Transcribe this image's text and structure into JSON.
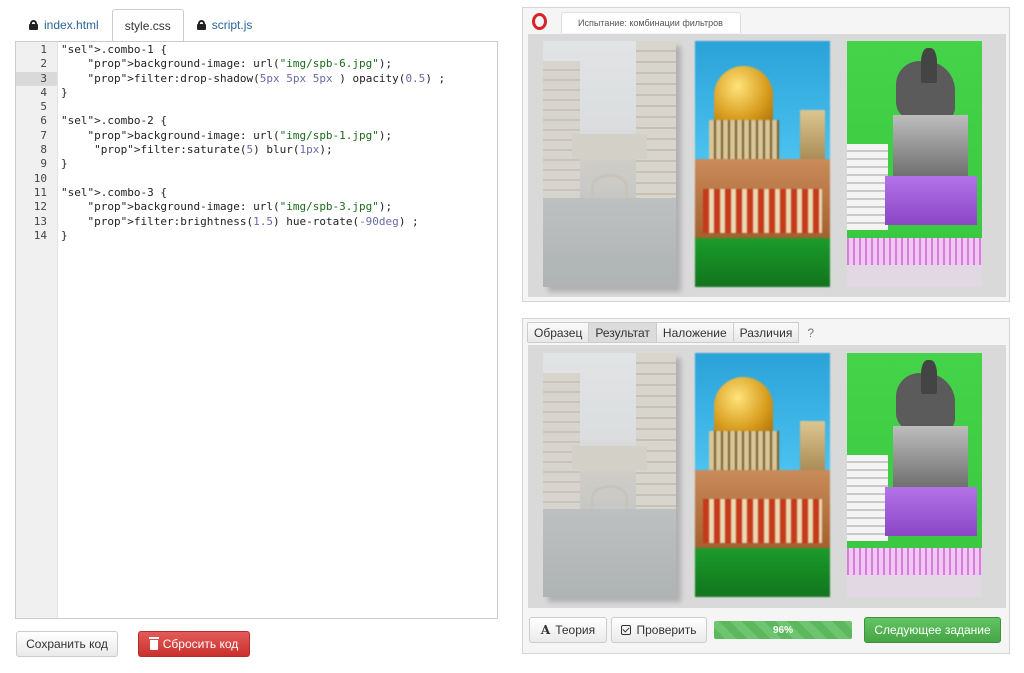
{
  "editor": {
    "tabs": [
      {
        "label": "index.html",
        "active": false
      },
      {
        "label": "style.css",
        "active": true
      },
      {
        "label": "script.js",
        "active": false
      }
    ],
    "active_line": 3,
    "lines": [
      ".combo-1 {",
      "    background-image: url(\"img/spb-6.jpg\");",
      "    filter:drop-shadow(5px 5px 5px ) opacity(0.5) ;",
      "}",
      "",
      ".combo-2 {",
      "    background-image: url(\"img/spb-1.jpg\");",
      "     filter:saturate(5) blur(1px);",
      "}",
      "",
      ".combo-3 {",
      "    background-image: url(\"img/spb-3.jpg\");",
      "    filter:brightness(1.5) hue-rotate(-90deg) ;",
      "}"
    ],
    "line_numbers": [
      "1",
      "2",
      "3",
      "4",
      "5",
      "6",
      "7",
      "8",
      "9",
      "10",
      "11",
      "12",
      "13",
      "14"
    ]
  },
  "actions": {
    "save_label": "Сохранить код",
    "reset_label": "Сбросить код"
  },
  "preview": {
    "browser_tab_title": "Испытание: комбинации фильтров",
    "browser_logo": "opera-logo"
  },
  "result": {
    "tabs": [
      {
        "label": "Образец",
        "active": false
      },
      {
        "label": "Результат",
        "active": true
      },
      {
        "label": "Наложение",
        "active": false
      },
      {
        "label": "Различия",
        "active": false
      }
    ],
    "help_label": "?"
  },
  "toolbar": {
    "theory_label": "Теория",
    "check_label": "Проверить",
    "progress_label": "96%",
    "progress_value": 0.96,
    "next_label": "Следующее задание"
  },
  "colors": {
    "accent_green": "#5cb85c",
    "danger_red": "#c9302c",
    "link_blue": "#2a6496"
  }
}
